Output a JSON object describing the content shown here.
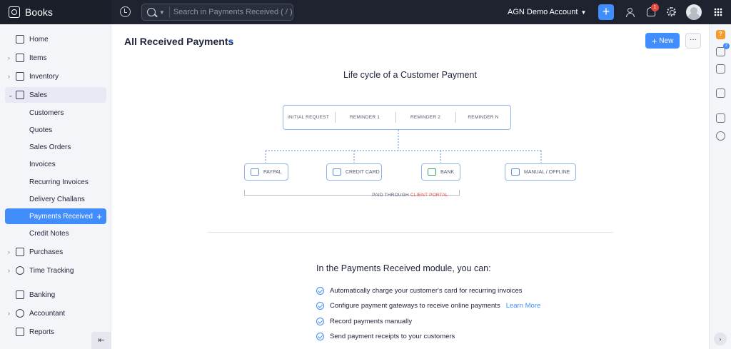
{
  "app": {
    "name": "Books",
    "search_placeholder": "Search in Payments Received ( / )",
    "org_name": "AGN Demo Account",
    "notification_count": "1"
  },
  "sidebar": {
    "items": [
      {
        "label": "Home"
      },
      {
        "label": "Items"
      },
      {
        "label": "Inventory"
      },
      {
        "label": "Sales"
      },
      {
        "label": "Customers"
      },
      {
        "label": "Quotes"
      },
      {
        "label": "Sales Orders"
      },
      {
        "label": "Invoices"
      },
      {
        "label": "Recurring Invoices"
      },
      {
        "label": "Delivery Challans"
      },
      {
        "label": "Payments Received"
      },
      {
        "label": "Credit Notes"
      },
      {
        "label": "Purchases"
      },
      {
        "label": "Time Tracking"
      },
      {
        "label": "Banking"
      },
      {
        "label": "Accountant"
      },
      {
        "label": "Reports"
      }
    ],
    "selected": "Payments Received"
  },
  "header": {
    "title": "All Received Payments",
    "new_label": "New",
    "more_label": "···"
  },
  "lifecycle": {
    "title": "Life cycle of a Customer Payment",
    "steps": [
      "INITIAL REQUEST",
      "REMINDER 1",
      "REMINDER 2",
      "REMINDER N"
    ],
    "methods": [
      "PAYPAL",
      "CREDIT CARD",
      "BANK",
      "MANUAL / OFFLINE"
    ],
    "paid_through": "PAID THROUGH",
    "portal": "CLIENT PORTAL"
  },
  "module": {
    "title": "In the Payments Received module, you can:",
    "features": [
      "Automatically charge your customer's card for recurring invoices",
      "Configure payment gateways to receive online payments",
      "Record payments manually",
      "Send payment receipts to your customers"
    ],
    "learn_more": "Learn More"
  },
  "rail": {
    "help_badge": "2"
  },
  "colors": {
    "accent": "#408dfb",
    "topbar": "#1f2330",
    "portal_red": "#e5483d"
  }
}
